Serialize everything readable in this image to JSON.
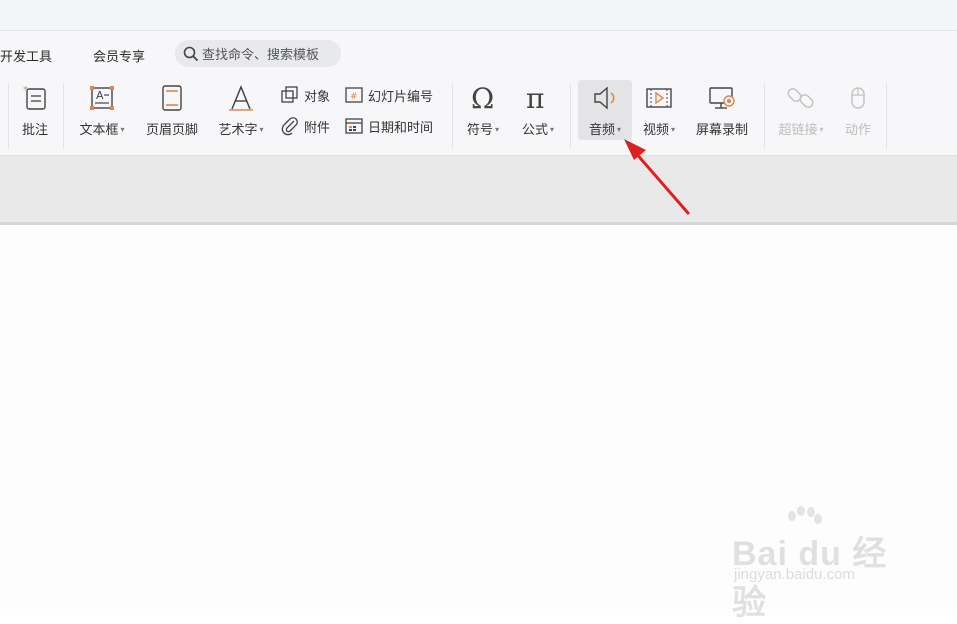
{
  "tabs": {
    "dev_tools": "开发工具",
    "member": "会员专享"
  },
  "search": {
    "placeholder": "查找命令、搜索模板"
  },
  "ribbon": {
    "comment": "批注",
    "textbox": "文本框",
    "header_footer": "页眉页脚",
    "art_text": "艺术字",
    "object": "对象",
    "slide_number": "幻灯片编号",
    "attachment": "附件",
    "date_time": "日期和时间",
    "symbol": "符号",
    "formula": "公式",
    "audio": "音频",
    "video": "视频",
    "screen_record": "屏幕录制",
    "hyperlink": "超链接",
    "action": "动作"
  },
  "watermark": {
    "brand": "Bai du 经验",
    "site": "jingyan.baidu.com"
  },
  "colors": {
    "accent_orange": "#e0854f",
    "arrow_red": "#e02020"
  }
}
